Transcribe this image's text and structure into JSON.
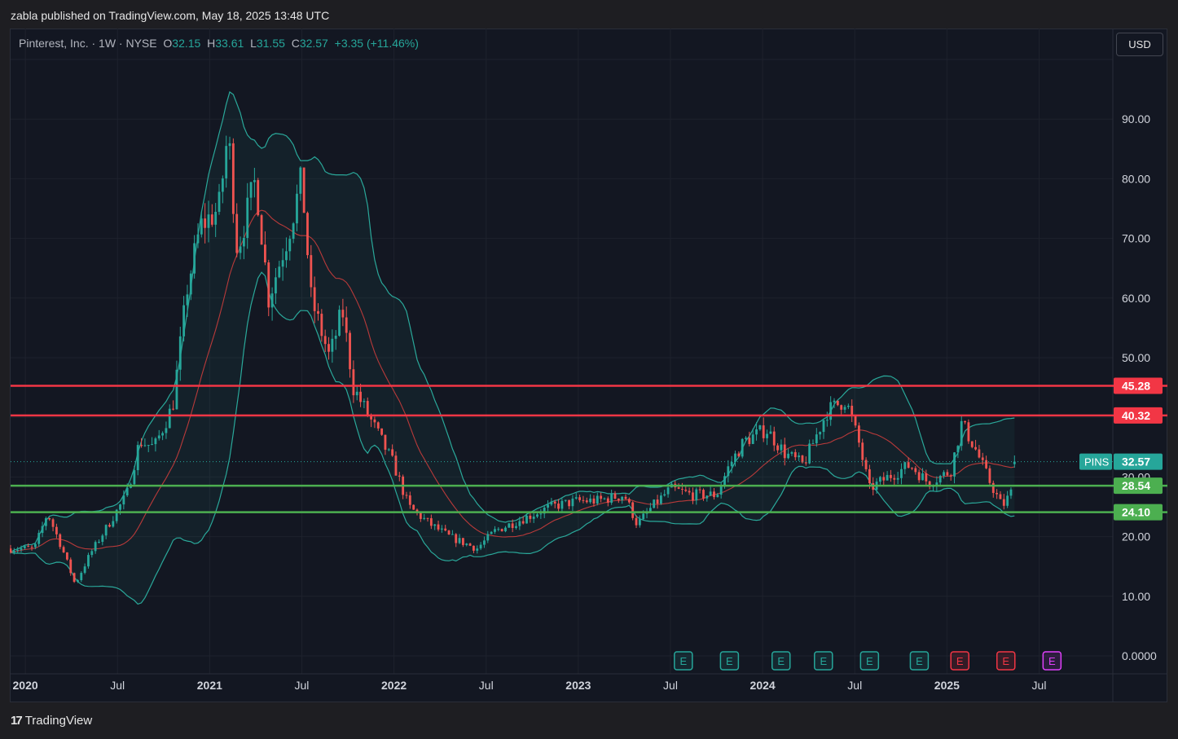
{
  "header": {
    "published_by": "zabla published on TradingView.com, May 18, 2025 13:48 UTC"
  },
  "legend": {
    "symbol": "Pinterest, Inc. · 1W · NYSE",
    "open_label": "O",
    "open": "32.15",
    "high_label": "H",
    "high": "33.61",
    "low_label": "L",
    "low": "31.55",
    "close_label": "C",
    "close": "32.57",
    "change": "+3.35 (+11.46%)"
  },
  "currency_button": "USD",
  "footer": {
    "brand": "TradingView",
    "logo_icon": "tradingview-logo-icon"
  },
  "chart_data": {
    "type": "candlestick",
    "title": "Pinterest, Inc. · 1W · NYSE",
    "ticker": "PINS",
    "last_price": 32.57,
    "ylim": [
      0,
      100
    ],
    "y_ticks": [
      0,
      10,
      20,
      30,
      50,
      60,
      70,
      80,
      90
    ],
    "y_tick_labels": [
      "0.0000",
      "10.00",
      "20.00",
      "30.00",
      "50.00",
      "60.00",
      "70.00",
      "80.00",
      "90.00"
    ],
    "xlim": [
      2019.92,
      2025.9
    ],
    "x_ticks": [
      2020.0,
      2020.5,
      2021.0,
      2021.5,
      2022.0,
      2022.5,
      2023.0,
      2023.5,
      2024.0,
      2024.5,
      2025.0,
      2025.5
    ],
    "x_tick_labels": [
      "2020",
      "Jul",
      "2021",
      "Jul",
      "2022",
      "Jul",
      "2023",
      "Jul",
      "2024",
      "Jul",
      "2025",
      "Jul"
    ],
    "x_tick_bold": [
      true,
      false,
      true,
      false,
      true,
      false,
      true,
      false,
      true,
      false,
      true,
      false
    ],
    "grid": true,
    "horizontal_levels": [
      {
        "value": 45.28,
        "label": "45.28",
        "color": "#f23645"
      },
      {
        "value": 40.32,
        "label": "40.32",
        "color": "#f23645"
      },
      {
        "value": 28.54,
        "label": "28.54",
        "color": "#4caf50"
      },
      {
        "value": 24.1,
        "label": "24.10",
        "color": "#4caf50"
      }
    ],
    "price_anchors": [
      [
        2019.92,
        18
      ],
      [
        2020.05,
        18
      ],
      [
        2020.12,
        24
      ],
      [
        2020.2,
        18
      ],
      [
        2020.27,
        12
      ],
      [
        2020.35,
        17
      ],
      [
        2020.45,
        22
      ],
      [
        2020.55,
        27
      ],
      [
        2020.62,
        36
      ],
      [
        2020.7,
        35
      ],
      [
        2020.8,
        42
      ],
      [
        2020.88,
        62
      ],
      [
        2020.95,
        72
      ],
      [
        2021.05,
        75
      ],
      [
        2021.1,
        88
      ],
      [
        2021.15,
        68
      ],
      [
        2021.25,
        80
      ],
      [
        2021.32,
        60
      ],
      [
        2021.42,
        70
      ],
      [
        2021.5,
        80
      ],
      [
        2021.55,
        60
      ],
      [
        2021.65,
        50
      ],
      [
        2021.72,
        58
      ],
      [
        2021.78,
        45
      ],
      [
        2021.9,
        38
      ],
      [
        2022.0,
        32
      ],
      [
        2022.08,
        25
      ],
      [
        2022.2,
        22
      ],
      [
        2022.3,
        20
      ],
      [
        2022.45,
        18
      ],
      [
        2022.55,
        21
      ],
      [
        2022.7,
        23
      ],
      [
        2022.85,
        25
      ],
      [
        2023.0,
        26
      ],
      [
        2023.1,
        26
      ],
      [
        2023.25,
        27
      ],
      [
        2023.32,
        22
      ],
      [
        2023.4,
        25
      ],
      [
        2023.5,
        28
      ],
      [
        2023.62,
        27
      ],
      [
        2023.75,
        27
      ],
      [
        2023.82,
        32
      ],
      [
        2023.9,
        36
      ],
      [
        2024.02,
        38
      ],
      [
        2024.12,
        34
      ],
      [
        2024.22,
        32
      ],
      [
        2024.35,
        41
      ],
      [
        2024.45,
        43
      ],
      [
        2024.52,
        36
      ],
      [
        2024.58,
        28
      ],
      [
        2024.68,
        30
      ],
      [
        2024.8,
        32
      ],
      [
        2024.9,
        29
      ],
      [
        2025.02,
        31
      ],
      [
        2025.08,
        39
      ],
      [
        2025.15,
        35
      ],
      [
        2025.22,
        30
      ],
      [
        2025.3,
        25
      ],
      [
        2025.36,
        28
      ],
      [
        2025.38,
        32.57
      ]
    ],
    "earnings_events": [
      {
        "x": 2023.57,
        "label": "E",
        "type": "past-beat"
      },
      {
        "x": 2023.82,
        "label": "E",
        "type": "past-beat"
      },
      {
        "x": 2024.1,
        "label": "E",
        "type": "past-beat"
      },
      {
        "x": 2024.33,
        "label": "E",
        "type": "past-beat"
      },
      {
        "x": 2024.58,
        "label": "E",
        "type": "past-beat"
      },
      {
        "x": 2024.85,
        "label": "E",
        "type": "past-beat"
      },
      {
        "x": 2025.07,
        "label": "E",
        "type": "past-miss"
      },
      {
        "x": 2025.32,
        "label": "E",
        "type": "past-miss"
      },
      {
        "x": 2025.57,
        "label": "E",
        "type": "upcoming"
      }
    ],
    "colors": {
      "up": "#26a69a",
      "down": "#ef5350",
      "band": "#2aa89a",
      "basis": "#b83a3a",
      "grid": "#1e222d",
      "background": "#131722",
      "earn_beat": "#26a69a",
      "earn_miss": "#f23645",
      "earn_future": "#e040fb"
    }
  }
}
